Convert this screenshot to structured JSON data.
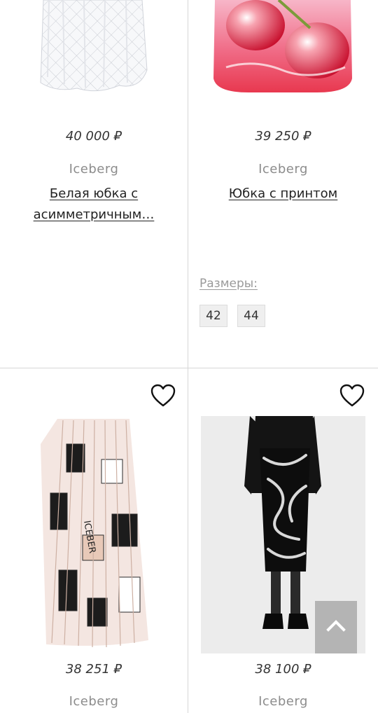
{
  "products": [
    {
      "price": "40 000 ₽",
      "brand": "Iceberg",
      "title": "Белая юбка с асимметричным…",
      "image": "white-lace-skirt"
    },
    {
      "price": "39 250 ₽",
      "brand": "Iceberg",
      "title": "Юбка с принтом",
      "image": "pink-cherry-print-skirt",
      "sizes_label": "Размеры:",
      "sizes": [
        "42",
        "44"
      ]
    },
    {
      "price": "38 251 ₽",
      "brand": "Iceberg",
      "image": "pleated-printed-skirt",
      "favorite_icon": "heart-outline-icon"
    },
    {
      "price": "38 100 ₽",
      "brand": "Iceberg",
      "image": "black-rope-print-skirt",
      "favorite_icon": "heart-outline-icon"
    }
  ],
  "scroll_top_icon": "chevron-up-icon",
  "colors": {
    "divider": "#d6d6d6",
    "brand_text": "#8c8c8c",
    "size_chip_bg": "#efefef",
    "scroll_top_bg": "#aaaaaa"
  }
}
